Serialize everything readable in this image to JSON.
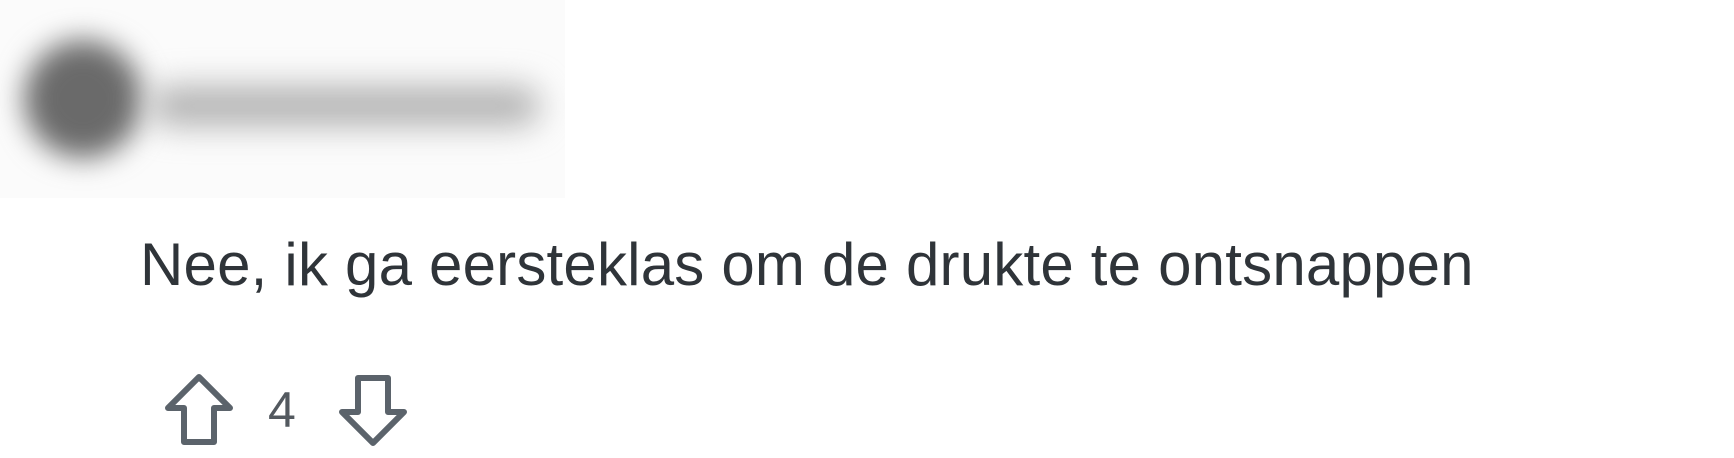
{
  "comment": {
    "body": "Nee, ik ga eersteklas om de drukte te ontsnappen",
    "vote_count": "4"
  },
  "icons": {
    "upvote": "arrow-up-outline-icon",
    "downvote": "arrow-down-outline-icon"
  },
  "colors": {
    "text": "#2f3439",
    "icon": "#5b636b",
    "background": "#ffffff"
  }
}
